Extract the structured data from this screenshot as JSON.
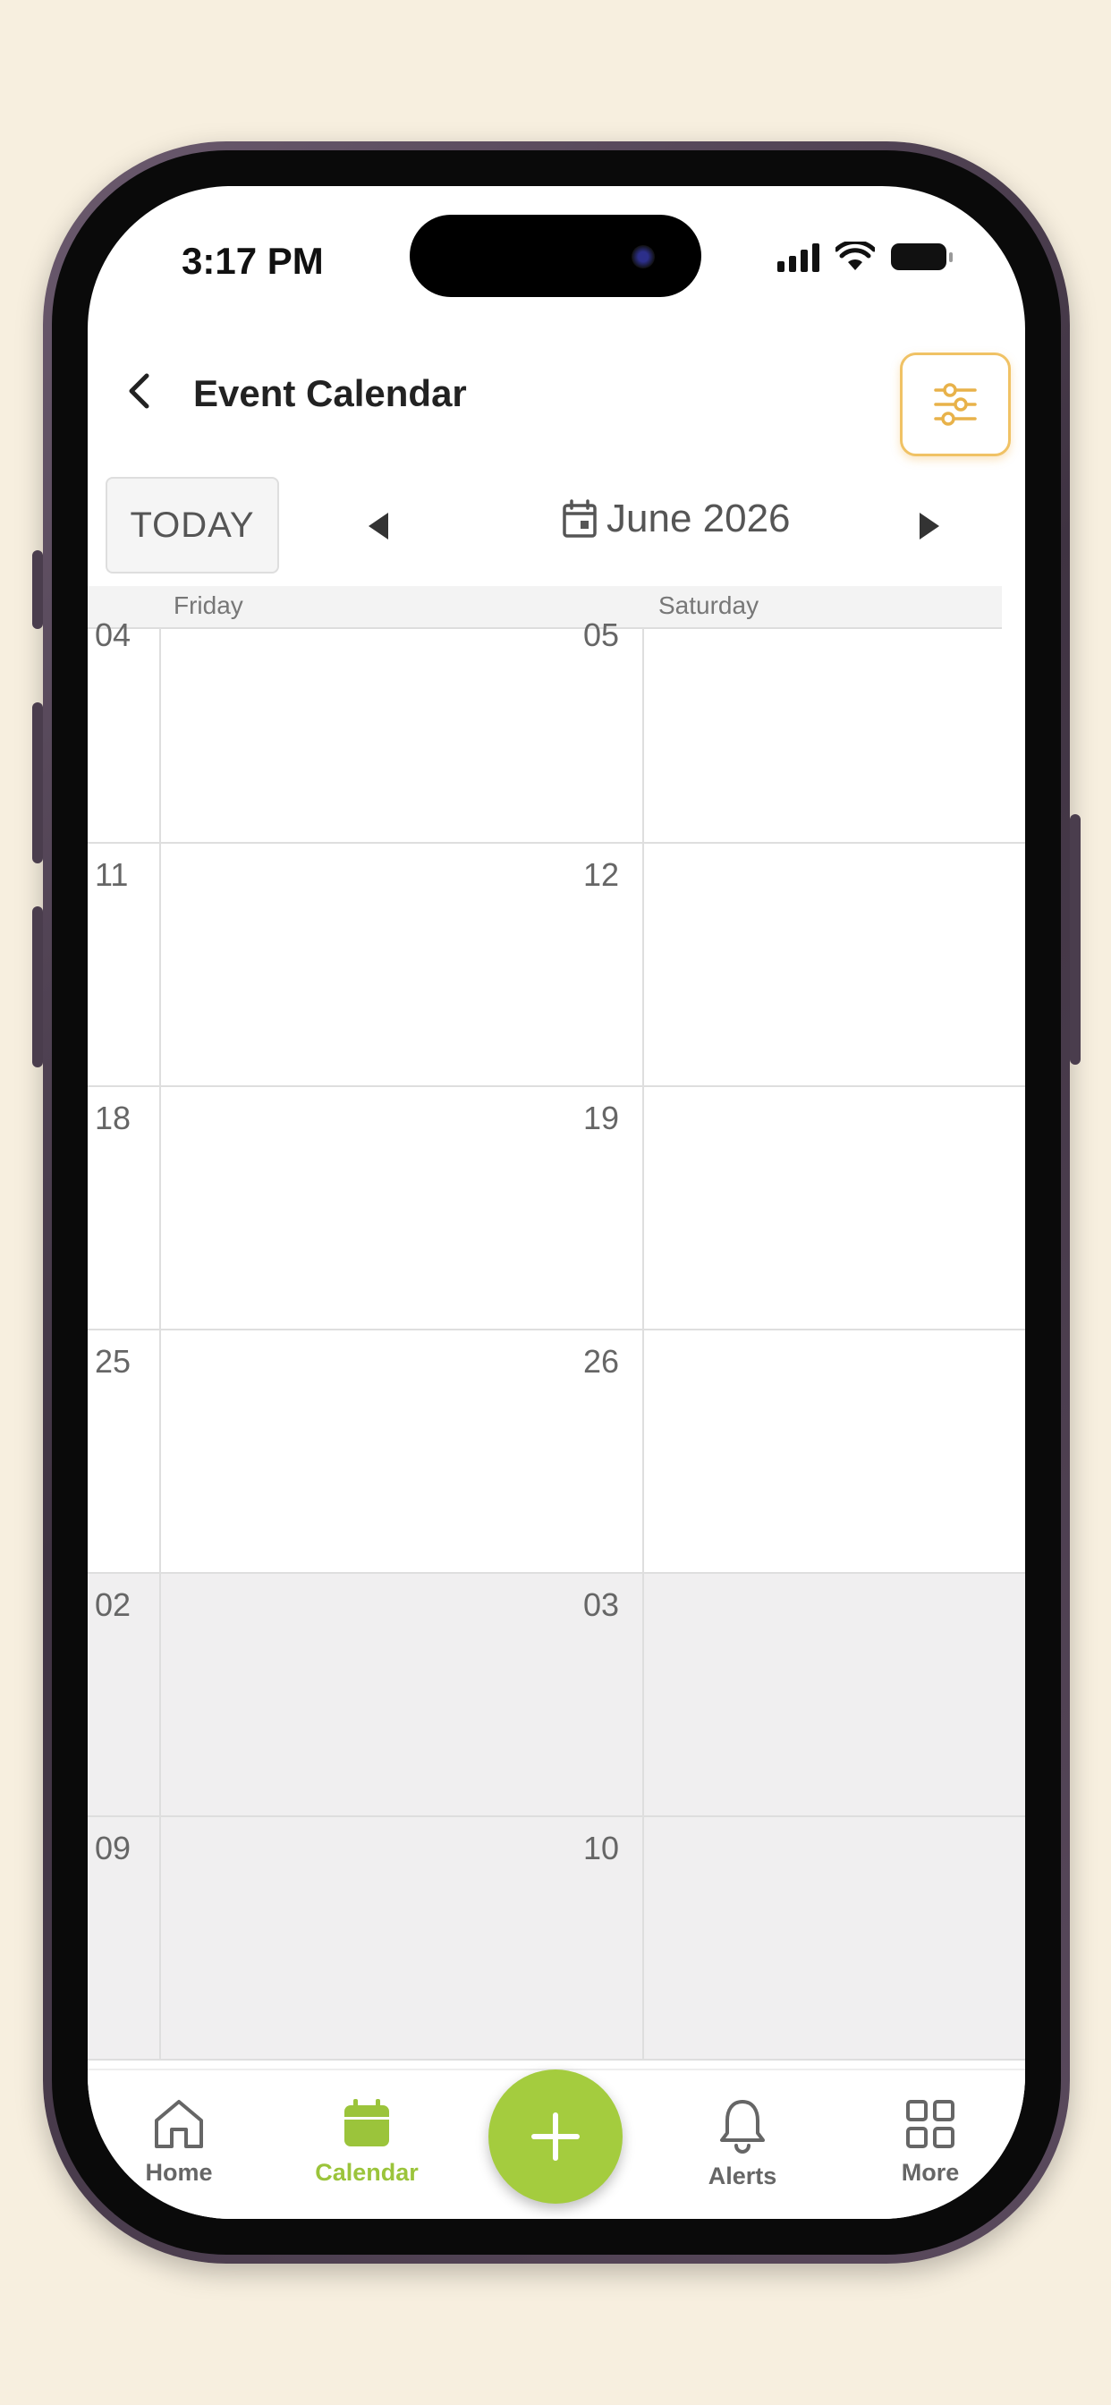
{
  "status_bar": {
    "time": "3:17 PM",
    "icons": [
      "cellular-signal-icon",
      "wifi-icon",
      "battery-icon"
    ]
  },
  "header": {
    "title": "Event Calendar",
    "back_icon": "chevron-left-icon",
    "filter_icon": "sliders-icon"
  },
  "toolbar": {
    "today_label": "TODAY",
    "prev_icon": "triangle-left-icon",
    "next_icon": "triangle-right-icon",
    "month_label": "June 2026",
    "calendar_icon": "calendar-icon"
  },
  "calendar": {
    "day_headers": [
      "Friday",
      "Saturday"
    ],
    "weeks": [
      {
        "week": "04",
        "friday": "05",
        "next_month": false
      },
      {
        "week": "11",
        "friday": "12",
        "next_month": false
      },
      {
        "week": "18",
        "friday": "19",
        "next_month": false
      },
      {
        "week": "25",
        "friday": "26",
        "next_month": false
      },
      {
        "week": "02",
        "friday": "03",
        "next_month": true
      },
      {
        "week": "09",
        "friday": "10",
        "next_month": true
      }
    ]
  },
  "tabbar": {
    "items": [
      {
        "label": "Home",
        "icon": "home-icon",
        "active": false
      },
      {
        "label": "Calendar",
        "icon": "calendar-icon",
        "active": true
      },
      {
        "label": "Alerts",
        "icon": "bell-icon",
        "active": false
      },
      {
        "label": "More",
        "icon": "grid-icon",
        "active": false
      }
    ],
    "fab_icon": "plus-icon"
  },
  "colors": {
    "accent": "#a4cc3e",
    "accent_text": "#9bc43b",
    "filter_border": "#f0c265",
    "page_background": "#f7efdf",
    "next_month_fill": "#f0eff0"
  }
}
